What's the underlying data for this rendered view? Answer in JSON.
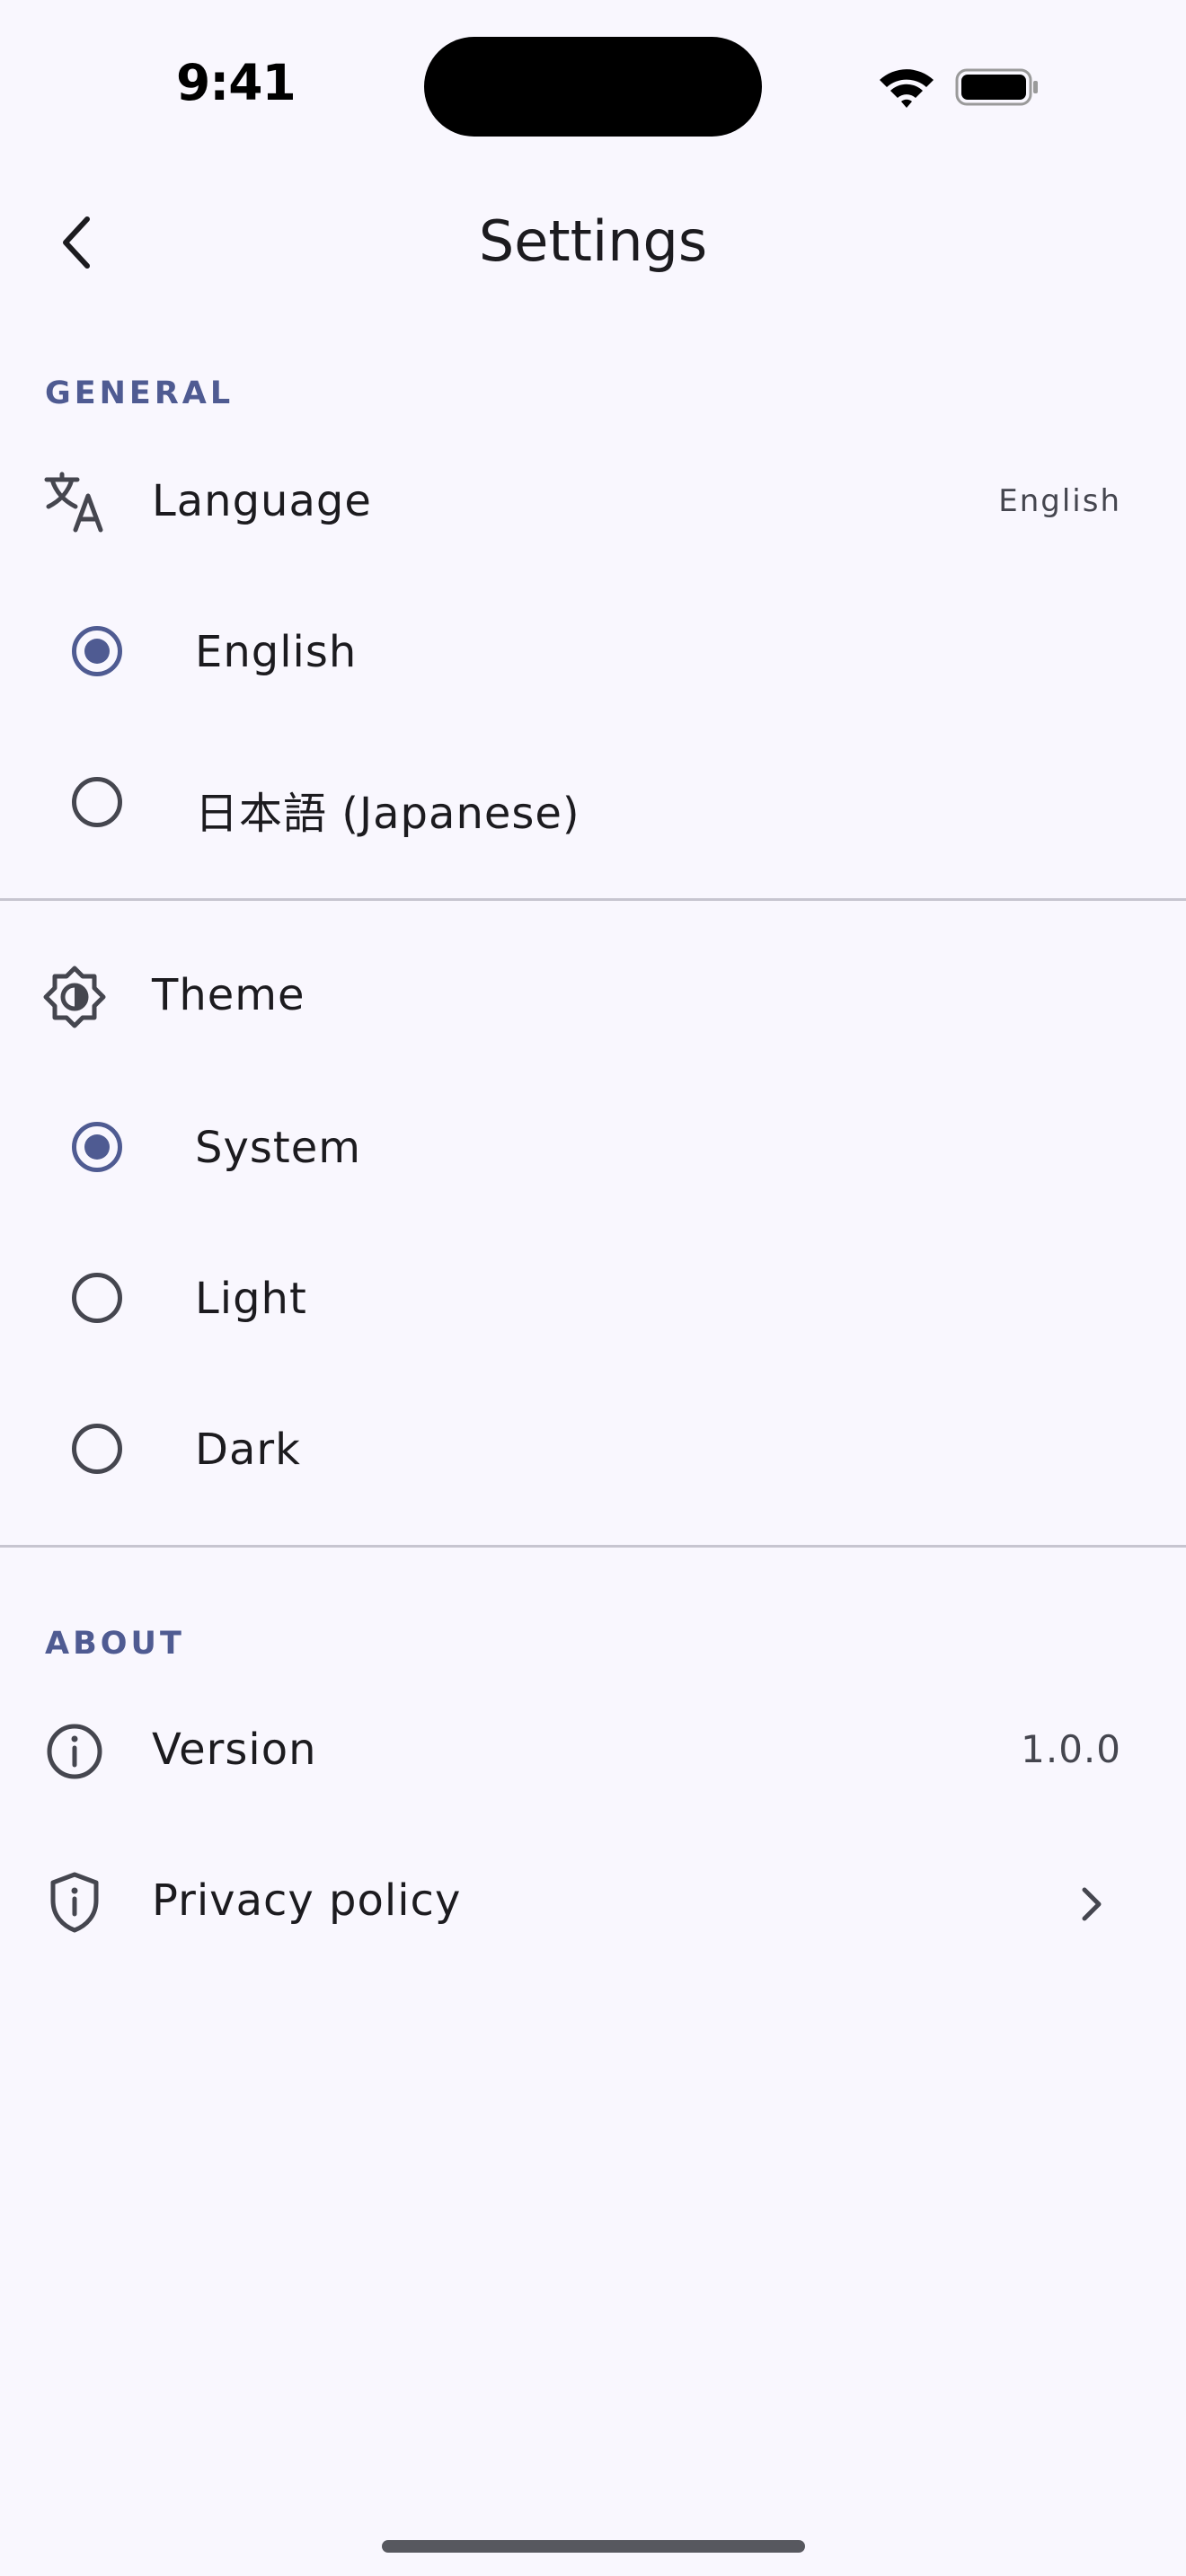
{
  "status_bar": {
    "time": "9:41"
  },
  "app_bar": {
    "title": "Settings"
  },
  "general": {
    "header": "GENERAL",
    "language": {
      "label": "Language",
      "value": "English",
      "options": [
        "English",
        "日本語 (Japanese)"
      ],
      "selected": "English"
    },
    "theme": {
      "label": "Theme",
      "options": [
        "System",
        "Light",
        "Dark"
      ],
      "selected": "System"
    }
  },
  "about": {
    "header": "ABOUT",
    "version": {
      "label": "Version",
      "value": "1.0.0"
    },
    "privacy": {
      "label": "Privacy policy"
    }
  },
  "colors": {
    "background": "#f9f7fe",
    "accent": "#4f5b92",
    "text": "#1c1b1f",
    "secondary_text": "#45464f",
    "divider": "#c7c5d0"
  }
}
